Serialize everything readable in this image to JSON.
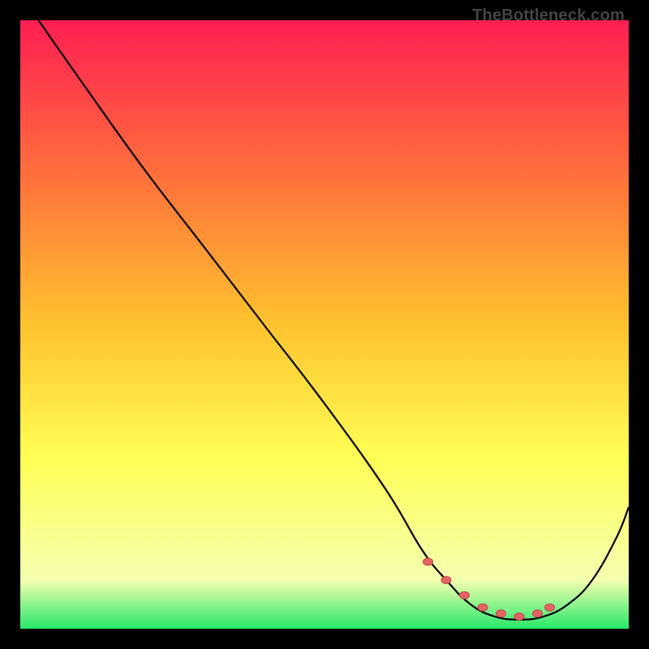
{
  "watermark": "TheBottleneck.com",
  "colors": {
    "top": "#ff1e52",
    "mid_upper": "#ff6e3c",
    "mid": "#ffc22e",
    "mid_lower": "#ffff55",
    "lower": "#f4ffb0",
    "bottom": "#27e86a",
    "curve": "#000000",
    "markers": "#e46363",
    "marker_stroke": "#c24747",
    "background": "#000000"
  },
  "chart_data": {
    "type": "line",
    "title": "",
    "xlabel": "",
    "ylabel": "",
    "xlim": [
      0,
      100
    ],
    "ylim": [
      0,
      100
    ],
    "annotations": [],
    "series": [
      {
        "name": "bottleneck-curve",
        "x": [
          3,
          10,
          20,
          30,
          40,
          50,
          60,
          66,
          70,
          74,
          78,
          82,
          86,
          90,
          94,
          98,
          100
        ],
        "y": [
          100,
          90,
          76,
          63,
          50,
          37,
          23,
          13,
          8,
          4,
          2,
          1.5,
          2,
          4,
          8,
          15,
          20
        ]
      }
    ],
    "markers": {
      "name": "sweet-spot",
      "x": [
        67,
        70,
        73,
        76,
        79,
        82,
        85,
        87
      ],
      "y": [
        11,
        8,
        5.5,
        3.5,
        2.5,
        2,
        2.5,
        3.5
      ]
    }
  }
}
